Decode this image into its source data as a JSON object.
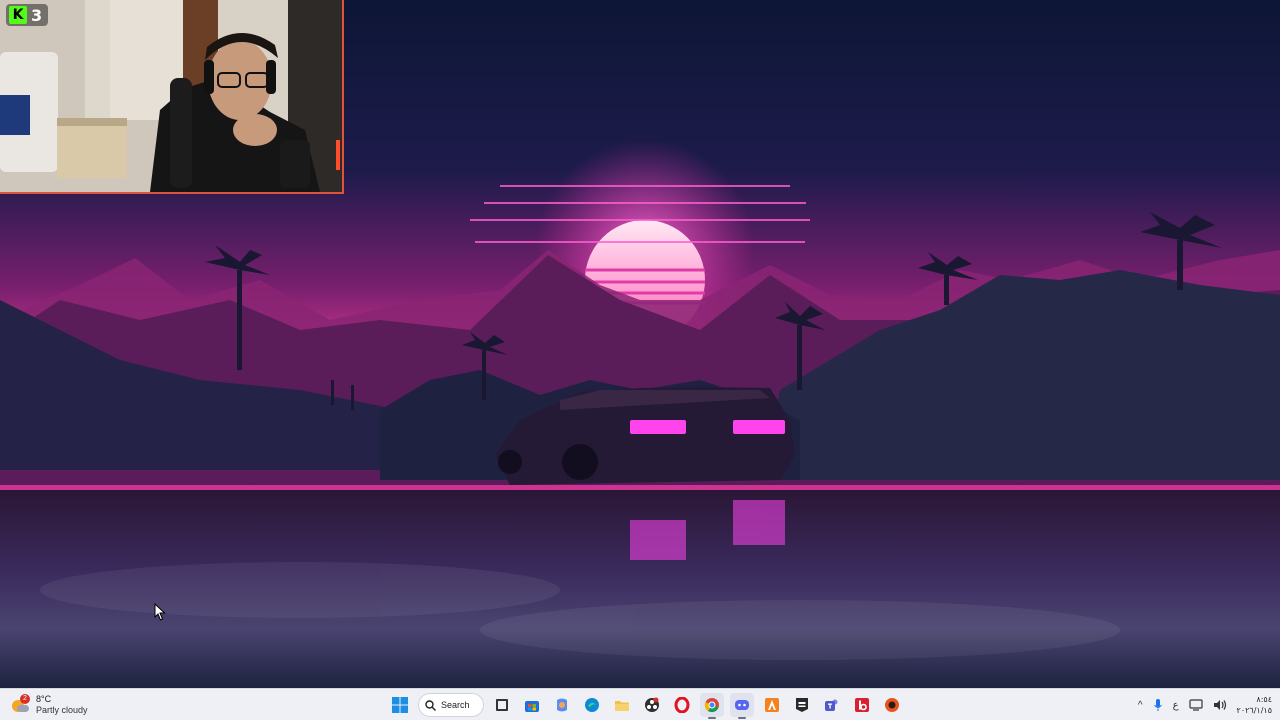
{
  "stream_overlay": {
    "platform_icon": "kick-logo-icon",
    "viewer_count": "3",
    "accent_color": "#53fc18",
    "border_color": "#e0533b"
  },
  "taskbar": {
    "weather": {
      "icon": "partly-cloudy-icon",
      "badge": "2",
      "temperature": "8°C",
      "condition": "Partly cloudy"
    },
    "search": {
      "label": "Search",
      "icon": "search-icon"
    },
    "apps": [
      {
        "name": "start",
        "icon": "windows-logo-icon"
      },
      {
        "name": "task-view",
        "icon": "task-view-icon"
      },
      {
        "name": "microsoft-store",
        "icon": "store-icon"
      },
      {
        "name": "copilot",
        "icon": "copilot-icon"
      },
      {
        "name": "edge",
        "icon": "edge-icon"
      },
      {
        "name": "file-explorer",
        "icon": "folder-icon"
      },
      {
        "name": "obs-studio",
        "icon": "obs-icon"
      },
      {
        "name": "opera",
        "icon": "opera-icon"
      },
      {
        "name": "chrome",
        "icon": "chrome-icon"
      },
      {
        "name": "discord",
        "icon": "discord-icon"
      },
      {
        "name": "app-orange",
        "icon": "orange-a-icon"
      },
      {
        "name": "epic-games",
        "icon": "epic-games-icon"
      },
      {
        "name": "teams",
        "icon": "teams-icon"
      },
      {
        "name": "app-red",
        "icon": "red-app-icon"
      },
      {
        "name": "app-round",
        "icon": "round-orange-icon"
      }
    ],
    "tray": {
      "chevron": "^",
      "language": "ع",
      "time": "٨:٥٤",
      "date": "٢٠٢٦/١/١٥"
    }
  },
  "colors": {
    "taskbar_bg": "#eef0f6",
    "sky_top": "#0f1a3d",
    "horizon": "#e0409c",
    "neon": "#ff3fe0"
  }
}
